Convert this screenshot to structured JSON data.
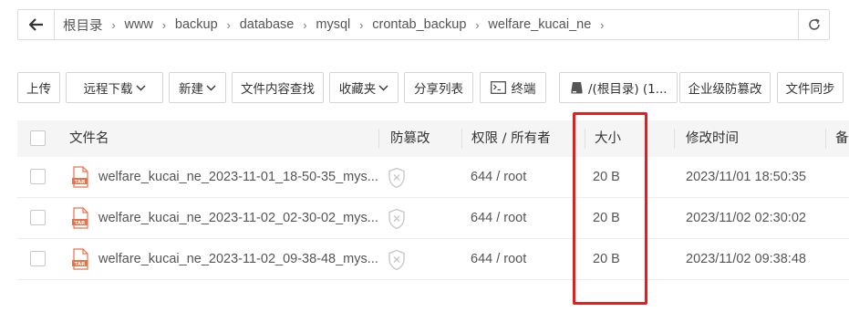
{
  "path_bar": {
    "crumbs": [
      "根目录",
      "www",
      "backup",
      "database",
      "mysql",
      "crontab_backup",
      "welfare_kucai_ne"
    ],
    "separator": "›"
  },
  "toolbar": {
    "upload": "上传",
    "remote_download": "远程下载",
    "new": "新建",
    "content_search": "文件内容查找",
    "favorites": "收藏夹",
    "share_list": "分享列表",
    "terminal": "终端",
    "disk": "/(根目录) (1...",
    "tamper_proof": "企业级防篡改",
    "file_sync": "文件同步"
  },
  "table": {
    "headers": {
      "name": "文件名",
      "tamper": "防篡改",
      "perm": "权限 / 所有者",
      "size": "大小",
      "mtime": "修改时间",
      "note": "备"
    },
    "rows": [
      {
        "name": "welfare_kucai_ne_2023-11-01_18-50-35_mys...",
        "perm": "644 / root",
        "size": "20 B",
        "mtime": "2023/11/01 18:50:35"
      },
      {
        "name": "welfare_kucai_ne_2023-11-02_02-30-02_mys...",
        "perm": "644 / root",
        "size": "20 B",
        "mtime": "2023/11/02 02:30:02"
      },
      {
        "name": "welfare_kucai_ne_2023-11-02_09-38-48_mys...",
        "perm": "644 / root",
        "size": "20 B",
        "mtime": "2023/11/02 09:38:48"
      }
    ],
    "file_icon_label": "TAR"
  },
  "colors": {
    "highlight": "#e02020",
    "file_icon": "#e8734a",
    "header_bg": "#f5f5f5",
    "border": "#dcdcdc"
  }
}
